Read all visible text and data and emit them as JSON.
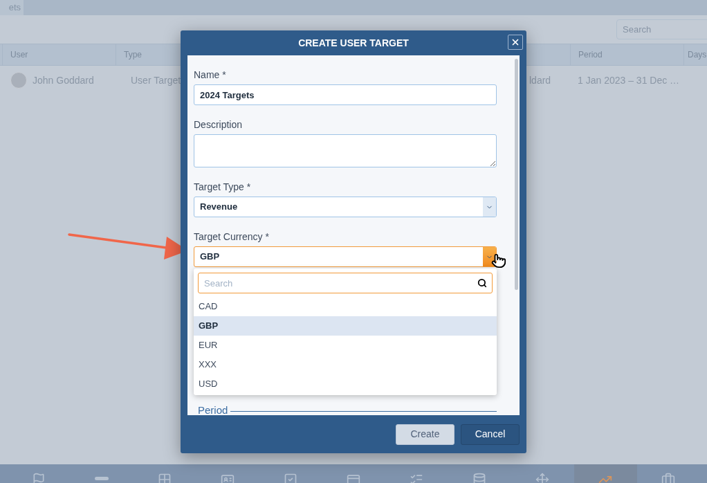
{
  "tab": {
    "label": "ets",
    "selected": true
  },
  "toolbar": {
    "search": {
      "placeholder": "Search"
    }
  },
  "table": {
    "columns": [
      "User",
      "Type",
      "Period",
      "Days"
    ],
    "rows": [
      {
        "user": "John Goddard",
        "type": "User Target",
        "column_3": "ldard",
        "period": "1 Jan 2023 – 31 Dec …"
      }
    ]
  },
  "dialog": {
    "title": "CREATE USER TARGET",
    "fields": [
      {
        "kind": "text",
        "label": "Name *",
        "value": "2024 Targets"
      },
      {
        "kind": "textarea",
        "label": "Description"
      },
      {
        "kind": "select",
        "label": "Target Type *",
        "value": "Revenue",
        "open": false
      },
      {
        "kind": "select",
        "label": "Target Currency *",
        "value": "GBP",
        "open": true
      }
    ],
    "dropdown": {
      "search": {
        "placeholder": "Search"
      },
      "options": [
        {
          "label": "CAD",
          "selected": false
        },
        {
          "label": "GBP",
          "selected": true
        },
        {
          "label": "EUR",
          "selected": false
        },
        {
          "label": "XXX",
          "selected": false
        },
        {
          "label": "USD",
          "selected": false
        }
      ]
    },
    "section": {
      "title": "Period"
    },
    "buttons": [
      {
        "kind": "primary",
        "label": "Create"
      },
      {
        "kind": "secondary",
        "label": "Cancel"
      }
    ]
  },
  "nav": [
    {
      "kind": "flag",
      "selected": false
    },
    {
      "kind": "bar",
      "selected": false
    },
    {
      "kind": "grid",
      "selected": false
    },
    {
      "kind": "card",
      "selected": false
    },
    {
      "kind": "check",
      "selected": false
    },
    {
      "kind": "idcard",
      "selected": false
    },
    {
      "kind": "list",
      "selected": false
    },
    {
      "kind": "database",
      "selected": false
    },
    {
      "kind": "move",
      "selected": false
    },
    {
      "kind": "chart",
      "selected": true
    },
    {
      "kind": "briefcase",
      "selected": false
    }
  ]
}
